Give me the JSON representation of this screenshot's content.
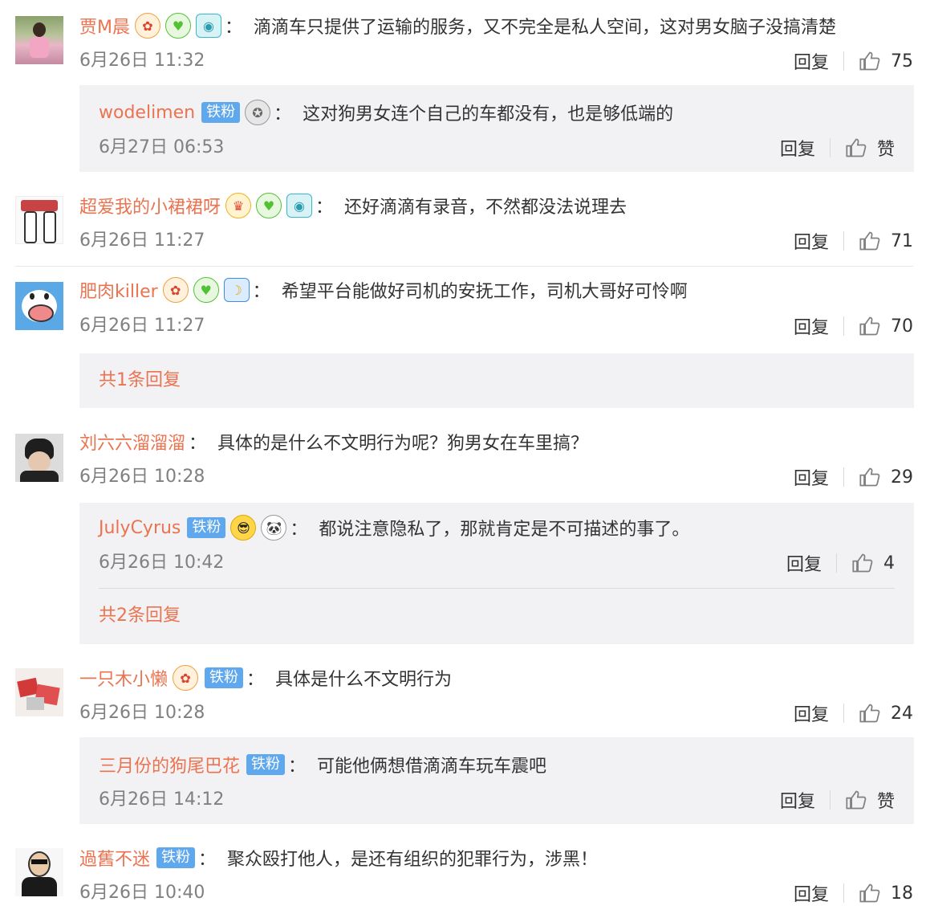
{
  "colors": {
    "name": "#eb7350",
    "text": "#333333",
    "meta": "#808080",
    "badge": "#5fa8ee",
    "subbox_bg": "#f2f2f5"
  },
  "reply_label": "回复",
  "colon": "：",
  "comments": [
    {
      "username": "贾M晨",
      "badges": [
        "lucky-rooster-icon",
        "green-heart-icon",
        "camera-icon"
      ],
      "text": "滴滴车只提供了运输的服务，又不完全是私人空间，这对男女脑子没搞清楚",
      "time": "6月26日 11:32",
      "likes": "75",
      "reply": {
        "username": "wodelimen",
        "fan_badge": "铁粉",
        "badges": [
          "medal-icon"
        ],
        "text": "这对狗男女连个自己的车都没有，也是够低端的",
        "time": "6月27日 06:53",
        "likes": "赞"
      }
    },
    {
      "username": "超爱我的小裙裙呀",
      "badges": [
        "crown-icon",
        "green-heart-icon",
        "camera-icon"
      ],
      "text": "还好滴滴有录音，不然都没法说理去",
      "time": "6月26日 11:27",
      "likes": "71"
    },
    {
      "username": "肥肉killer",
      "badges": [
        "lucky-rooster-icon",
        "green-heart-icon",
        "moon-icon"
      ],
      "text": "希望平台能做好司机的安抚工作，司机大哥好可怜啊",
      "time": "6月26日 11:27",
      "likes": "70",
      "more": "共1条回复"
    },
    {
      "username": "刘六六溜溜溜",
      "text": "具体的是什么不文明行为呢？狗男女在车里搞？",
      "time": "6月26日 10:28",
      "likes": "29",
      "reply": {
        "username": "JulyCyrus",
        "fan_badge": "铁粉",
        "badges": [
          "cool-cat-emoji",
          "panda-emoji"
        ],
        "text": "都说注意隐私了，那就肯定是不可描述的事了。",
        "time": "6月26日 10:42",
        "likes": "4"
      },
      "more": "共2条回复"
    },
    {
      "username": "一只木小懒",
      "badges": [
        "lucky-rooster-icon"
      ],
      "fan_badge": "铁粉",
      "text": "具体是什么不文明行为",
      "time": "6月26日 10:28",
      "likes": "24",
      "reply": {
        "username": "三月份的狗尾巴花",
        "fan_badge": "铁粉",
        "text": "可能他俩想借滴滴车玩车震吧",
        "time": "6月26日 14:12",
        "likes": "赞"
      }
    },
    {
      "username": "過舊不迷",
      "fan_badge": "铁粉",
      "text": "聚众殴打他人，是还有组织的犯罪行为，涉黑！",
      "time": "6月26日 10:40",
      "likes": "18"
    }
  ]
}
